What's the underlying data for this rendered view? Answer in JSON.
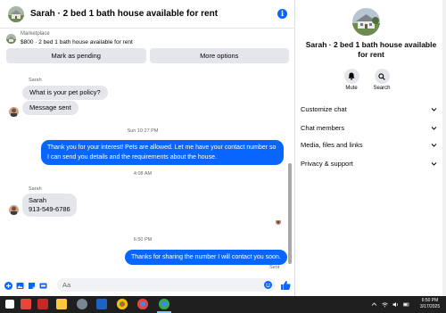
{
  "header": {
    "title": "Sarah · 2 bed 1 bath house available for rent",
    "info_glyph": "i"
  },
  "marketplace": {
    "source": "Marketplace",
    "listing": "$800 · 2 bed 1 bath house available for rent"
  },
  "actions": {
    "pending_label": "Mark as pending",
    "more_label": "More options"
  },
  "messages": {
    "sender_1": "Sarah",
    "in_1": "What is your pet policy?",
    "in_2": "Message sent",
    "ts_1": "Sun 10:27 PM",
    "out_1": "Thank you for your interest! Pets are allowed. Let me have your contact number so I can send you details and the requirements about the house.",
    "ts_2": "4:08 AM",
    "sender_2": "Sarah",
    "in_3_name": "Sarah",
    "in_3_phone": "913-549-6786",
    "ts_3": "6:50 PM",
    "out_2": "Thanks for sharing the number I will contact you soon.",
    "status": "Sent"
  },
  "composer": {
    "placeholder": "Aa"
  },
  "details": {
    "title": "Sarah · 2 bed 1 bath house available for rent",
    "mute_label": "Mute",
    "search_label": "Search",
    "sections": [
      "Customize chat",
      "Chat members",
      "Media, files and links",
      "Privacy & support"
    ]
  },
  "taskbar": {
    "time": "6:50 PM",
    "date": "3/17/2025"
  },
  "colors": {
    "accent": "#0866ff",
    "bubble_in": "#e4e6eb",
    "taskbar": "#1f1f1f"
  }
}
